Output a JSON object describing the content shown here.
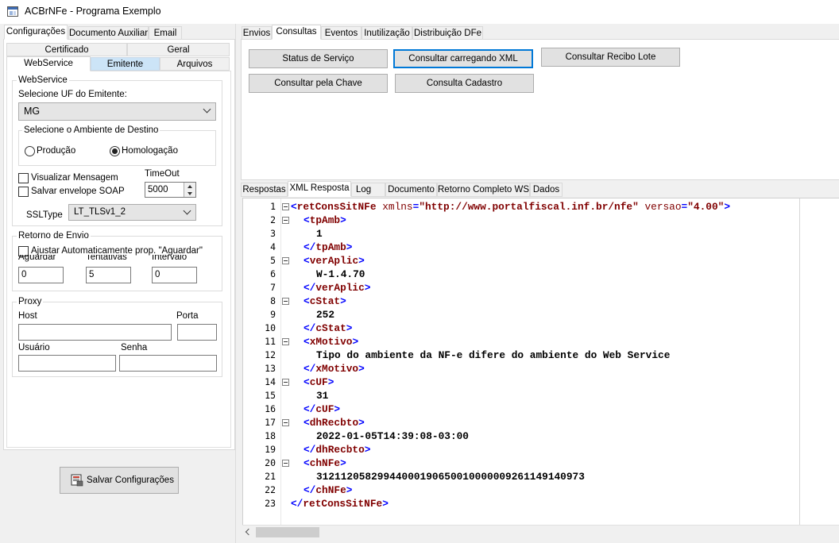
{
  "window": {
    "title": "ACBrNFe - Programa Exemplo"
  },
  "left": {
    "tabs": [
      "Configurações",
      "Documento Auxiliar",
      "Email"
    ],
    "subtabs_row1": [
      "Certificado",
      "Geral"
    ],
    "subtabs_row2": [
      "WebService",
      "Emitente",
      "Arquivos"
    ],
    "webservice": {
      "group_title": "WebService",
      "uf_label": "Selecione UF do Emitente:",
      "uf_value": "MG",
      "ambiente_title": "Selecione o Ambiente de Destino",
      "producao": "Produção",
      "homologacao": "Homologação",
      "visualizar": "Visualizar Mensagem",
      "salvar_envelope": "Salvar envelope SOAP",
      "timeout_label": "TimeOut",
      "timeout_value": "5000",
      "ssltype_label": "SSLType",
      "ssltype_value": "LT_TLSv1_2"
    },
    "retorno": {
      "title": "Retorno de Envio",
      "ajustar": "Ajustar Automaticamente prop. \"Aguardar\"",
      "aguardar_label": "Aguardar",
      "tentativas_label": "Tentativas",
      "intervalo_label": "Intervalo",
      "aguardar_value": "0",
      "tentativas_value": "5",
      "intervalo_value": "0"
    },
    "proxy": {
      "title": "Proxy",
      "host_label": "Host",
      "porta_label": "Porta",
      "usuario_label": "Usuário",
      "senha_label": "Senha"
    },
    "save_button": "Salvar Configurações"
  },
  "right": {
    "tabs": [
      "Envios",
      "Consultas",
      "Eventos",
      "Inutilização",
      "Distribuição DFe"
    ],
    "buttons": [
      "Status de Serviço",
      "Consultar carregando XML",
      "Consultar Recibo Lote",
      "Consultar pela Chave",
      "Consulta Cadastro"
    ],
    "result_tabs": [
      "Respostas",
      "XML Resposta",
      "Log",
      "Documento",
      "Retorno Completo WS",
      "Dados"
    ]
  },
  "xml": {
    "line_numbers": [
      "1",
      "2",
      "3",
      "4",
      "5",
      "6",
      "7",
      "8",
      "9",
      "10",
      "11",
      "12",
      "13",
      "14",
      "15",
      "16",
      "17",
      "18",
      "19",
      "20",
      "21",
      "22",
      "23"
    ],
    "root_open_tag": "retConsSitNFe",
    "root_attr1_name": "xmlns",
    "root_attr1_value": "\"http://www.portalfiscal.inf.br/nfe\"",
    "root_attr2_name": "versao",
    "root_attr2_value": "\"4.00\"",
    "elements": [
      {
        "name": "tpAmb",
        "value": "1"
      },
      {
        "name": "verAplic",
        "value": "W-1.4.70"
      },
      {
        "name": "cStat",
        "value": "252"
      },
      {
        "name": "xMotivo",
        "value": "Tipo do ambiente da NF-e difere do ambiente do Web Service"
      },
      {
        "name": "cUF",
        "value": "31"
      },
      {
        "name": "dhRecbto",
        "value": "2022-01-05T14:39:08-03:00"
      },
      {
        "name": "chNFe",
        "value": "31211205829944000190650010000009261149140973"
      }
    ],
    "root_close_tag": "retConsSitNFe"
  }
}
